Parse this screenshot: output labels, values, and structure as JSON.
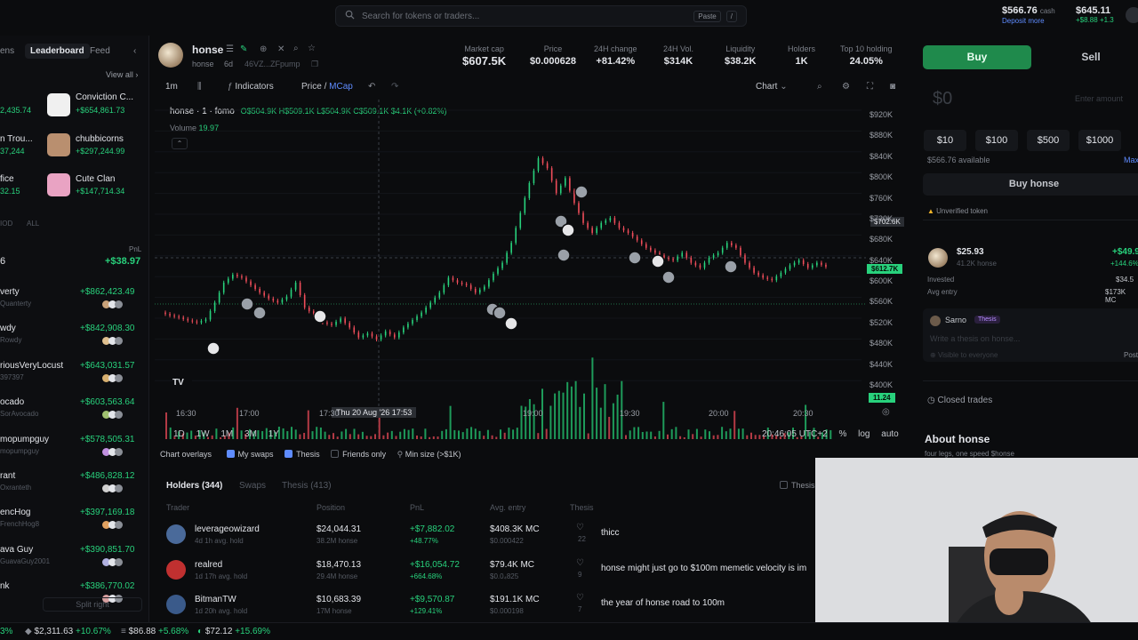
{
  "topbar": {
    "search_placeholder": "Search for tokens or traders...",
    "paste_label": "Paste",
    "slash_key": "/",
    "cash_amount": "$566.76",
    "cash_label": "cash",
    "deposit_label": "Deposit more",
    "portfolio_amount": "$645.11",
    "portfolio_change": "+$8.88",
    "portfolio_pct": "+1.3"
  },
  "leftpanel": {
    "tab_partial": "ens",
    "tab_leaderboard": "Leaderboard",
    "tab_feed": "Feed",
    "view_all": "View all",
    "featured": [
      {
        "name": "Conviction C...",
        "value": "+$654,861.73",
        "left": "2,435.74"
      },
      {
        "name": "chubbicorns",
        "value": "+$297,244.99",
        "left": "n Trou...",
        "left2": "37,244"
      },
      {
        "name": "Cute Clan",
        "value": "+$147,714.34",
        "left": "fice",
        "left2": "32.15"
      }
    ],
    "filter_partial": "IOD",
    "filter_all": "ALL",
    "pnl_label": "PnL",
    "my_rank": "6",
    "my_pnl": "+$38.97",
    "traders": [
      {
        "name": "verty",
        "sub": "Quanterty",
        "pnl": "+$862,423.49"
      },
      {
        "name": "wdy",
        "sub": "Rowdy",
        "pnl": "+$842,908.30"
      },
      {
        "name": "riousVeryLocust",
        "sub": "397397",
        "pnl": "+$643,031.57"
      },
      {
        "name": "ocado",
        "sub": "SorAvocado",
        "pnl": "+$603,563.64"
      },
      {
        "name": "mopumpguy",
        "sub": "mopumpguy",
        "pnl": "+$578,505.31"
      },
      {
        "name": "rant",
        "sub": "Oxranteth",
        "pnl": "+$486,828.12"
      },
      {
        "name": "encHog",
        "sub": "FrenchHog8",
        "pnl": "+$397,169.18"
      },
      {
        "name": "ava Guy",
        "sub": "GuavaGuy2001",
        "pnl": "+$390,851.70"
      },
      {
        "name": "nk",
        "sub": "",
        "pnl": "+$386,770.02"
      }
    ],
    "split_right": "Split right"
  },
  "token": {
    "name": "honse",
    "ticker": "honse",
    "age": "6d",
    "address": "46VZ...ZFpump",
    "stats": [
      {
        "label": "Market cap",
        "value": "$607.5K"
      },
      {
        "label": "Price",
        "value": "$0.000628"
      },
      {
        "label": "24H change",
        "value": "+81.42%"
      },
      {
        "label": "24H Vol.",
        "value": "$314K"
      },
      {
        "label": "Liquidity",
        "value": "$38.2K"
      },
      {
        "label": "Holders",
        "value": "1K"
      },
      {
        "label": "Top 10 holding",
        "value": "24.05%"
      }
    ]
  },
  "toolbar": {
    "interval": "1m",
    "indicators": "Indicators",
    "price_label": "Price",
    "mcap_label": "MCap",
    "chart_label": "Chart"
  },
  "chart_info": {
    "symbol": "honse · 1 · fomo",
    "ohlc": "O$504.9K H$509.1K L$504.9K C$509.1K $4.1K (+0.82%)",
    "volume_label": "Volume",
    "volume_value": "19.97",
    "crosshair_time": "Thu 20 Aug '26  17:53",
    "crosshair_price": "$702.6K",
    "last_price": "$612.7K",
    "volume_tag": "11.24",
    "clock": "20:46:05 UTC+2",
    "pct": "%",
    "log": "log",
    "auto": "auto"
  },
  "chart_data": {
    "type": "line",
    "yticks": [
      "$920K",
      "$880K",
      "$840K",
      "$800K",
      "$760K",
      "$720K",
      "$680K",
      "$640K",
      "$600K",
      "$560K",
      "$520K",
      "$480K",
      "$440K",
      "$400K"
    ],
    "xticks": [
      "16:30",
      "17:00",
      "17:30",
      "19:00",
      "19:30",
      "20:00",
      "20:30"
    ],
    "ylim": [
      380,
      930
    ],
    "series": [
      {
        "values": [
          520,
          514,
          510,
          504,
          500,
          506,
          540,
          580,
          596,
          590,
          575,
          560,
          548,
          540,
          552,
          580,
          530,
          515,
          500,
          495,
          508,
          490,
          470,
          478,
          466,
          482,
          470,
          490,
          505,
          520,
          540,
          560,
          590,
          580,
          575,
          560,
          572,
          598,
          620,
          660,
          720,
          780,
          830,
          810,
          760,
          790,
          740,
          700,
          680,
          700,
          710,
          690,
          680,
          665,
          650,
          640,
          630,
          625,
          640,
          620,
          610,
          630,
          640,
          660,
          650,
          620,
          600,
          590,
          585,
          600,
          615,
          625,
          610,
          620,
          612
        ]
      }
    ]
  },
  "ranges": [
    "1D",
    "1W",
    "1M",
    "3M",
    "1Y"
  ],
  "overlays": {
    "label": "Chart overlays",
    "my_swaps": "My swaps",
    "thesis": "Thesis",
    "friends_only": "Friends only",
    "min_size": "Min size (>$1K)"
  },
  "holders": {
    "tab_holders": "Holders (344)",
    "tab_swaps": "Swaps",
    "tab_thesis": "Thesis (413)",
    "thesis_toggle": "Thesis",
    "columns": [
      "Trader",
      "Position",
      "PnL",
      "Avg. entry",
      "Thesis"
    ],
    "rows": [
      {
        "name": "leverageowizard",
        "sub": "4d 1h avg. hold",
        "position": "$24,044.31",
        "amount": "38.2M honse",
        "pnl": "+$7,882.02",
        "pnl_pct": "+48.77%",
        "entry": "$408.3K MC",
        "entry_price": "$0.000422",
        "likes": "22",
        "thesis": "thicc"
      },
      {
        "name": "realred",
        "sub": "1d 17h avg. hold",
        "position": "$18,470.13",
        "amount": "29.4M honse",
        "pnl": "+$16,054.72",
        "pnl_pct": "+664.68%",
        "entry": "$79.4K MC",
        "entry_price": "$0.0₄825",
        "likes": "9",
        "thesis": "honse might just go to $100m memetic velocity is im"
      },
      {
        "name": "BitmanTW",
        "sub": "1d 20h avg. hold",
        "position": "$10,683.39",
        "amount": "17M honse",
        "pnl": "+$9,570.87",
        "pnl_pct": "+129.41%",
        "entry": "$191.1K MC",
        "entry_price": "$0.000198",
        "likes": "7",
        "thesis": "the year of honse road to 100m"
      }
    ]
  },
  "rightpanel": {
    "buy": "Buy",
    "sell": "Sell",
    "amount_placeholder": "$0",
    "enter_amount": "Enter amount",
    "quick": [
      "$10",
      "$100",
      "$500",
      "$1000"
    ],
    "available": "$566.76 available",
    "max": "Max",
    "buy_button": "Buy honse",
    "unverified": "Unverified token",
    "position_value": "$25.93",
    "position_amount": "41.2K honse",
    "position_pnl": "+$49.9",
    "position_pct": "+144.6%",
    "invested_label": "Invested",
    "invested_value": "$34.5",
    "avg_entry_label": "Avg entry",
    "avg_entry_value": "$173K MC",
    "author": "Sarno",
    "author_badge": "Thesis",
    "thesis_placeholder": "Write a thesis on honse...",
    "visibility": "Visible to everyone",
    "post": "Post",
    "closed_trades": "Closed trades",
    "about_title": "About honse",
    "about_text": "four legs, one speed $honse"
  },
  "bottombar": {
    "item1_pct": "3%",
    "item2_price": "$2,311.63",
    "item2_pct": "+10.67%",
    "item3_price": "$86.88",
    "item3_pct": "+5.68%",
    "item4_price": "$72.12",
    "item4_pct": "+15.69%"
  },
  "colors": {
    "accent_green": "#28d17c",
    "buy_bg": "#1f8a4c",
    "bg": "#0b0c0e"
  }
}
